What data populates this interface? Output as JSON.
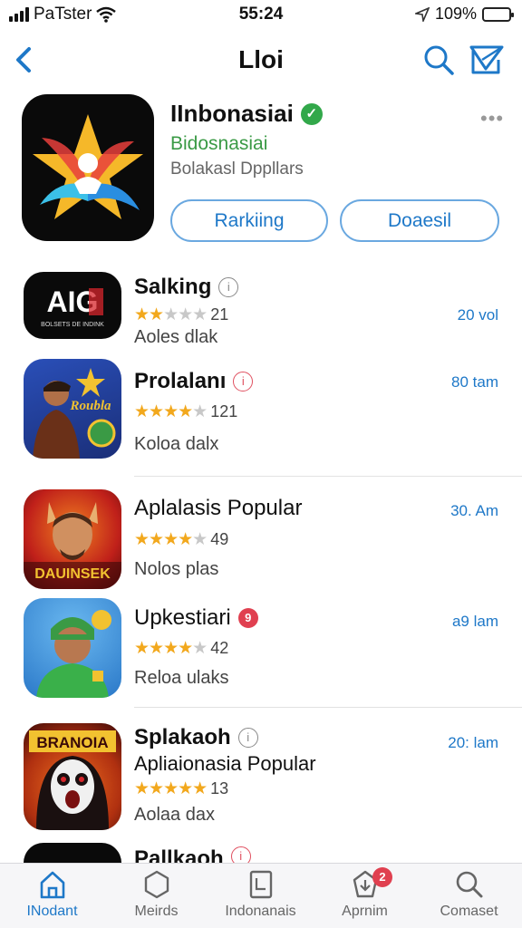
{
  "status_bar": {
    "carrier": "PaTster",
    "time": "55:24",
    "battery": "109%"
  },
  "nav": {
    "title": "Lloi"
  },
  "hero": {
    "name": "IInbonasiai",
    "developer": "Bidosnasiai",
    "category": "Bolakasl Dppllars",
    "ranking_label": "Rarkiing",
    "detail_label": "Doaesil"
  },
  "apps": [
    {
      "name": "Salking",
      "badge": "i",
      "rating": 2,
      "rating_count": "21",
      "description": "Aoles dlak",
      "time": "20 vol",
      "icon_text": "AIG",
      "icon_subtext": "BOLSETS DE INDINK"
    },
    {
      "name": "Prolalanı",
      "badge": "i",
      "rating": 4,
      "rating_count": "121",
      "description": "Koloa dalx",
      "time": "80 tam",
      "icon_text": "Roubla"
    },
    {
      "name": "Aplalasis Popular",
      "badge": "",
      "rating": 4,
      "rating_count": "49",
      "description": "Nolos plas",
      "time": "30. Am",
      "icon_text": "DAUINSEK"
    },
    {
      "name": "Upkestiari",
      "badge": "9",
      "rating": 4,
      "rating_count": "42",
      "description": "Reloa ulaks",
      "time": "a9 lam",
      "icon_text": ""
    },
    {
      "name": "Splakaoh",
      "badge": "i",
      "subtitle": "Apliaionasia Popular",
      "rating": 5,
      "rating_count": "13",
      "description": "Aolaa dax",
      "time": "20: lam",
      "icon_text": "BRANOIA"
    },
    {
      "name": "Pallkaoh",
      "badge": "i",
      "rating": 0,
      "rating_count": "",
      "description": "",
      "time": ""
    }
  ],
  "tabs": [
    {
      "label": "INodant",
      "icon": "home-icon",
      "active": true
    },
    {
      "label": "Meirds",
      "icon": "hexagon-icon",
      "active": false
    },
    {
      "label": "Indonanais",
      "icon": "document-icon",
      "active": false
    },
    {
      "label": "Aprnim",
      "icon": "updates-icon",
      "active": false,
      "badge": "2"
    },
    {
      "label": "Comaset",
      "icon": "search-icon",
      "active": false
    }
  ],
  "colors": {
    "accent": "#1e78c8",
    "star": "#f2a81d",
    "verified": "#32a84a",
    "badge": "#e04050"
  }
}
